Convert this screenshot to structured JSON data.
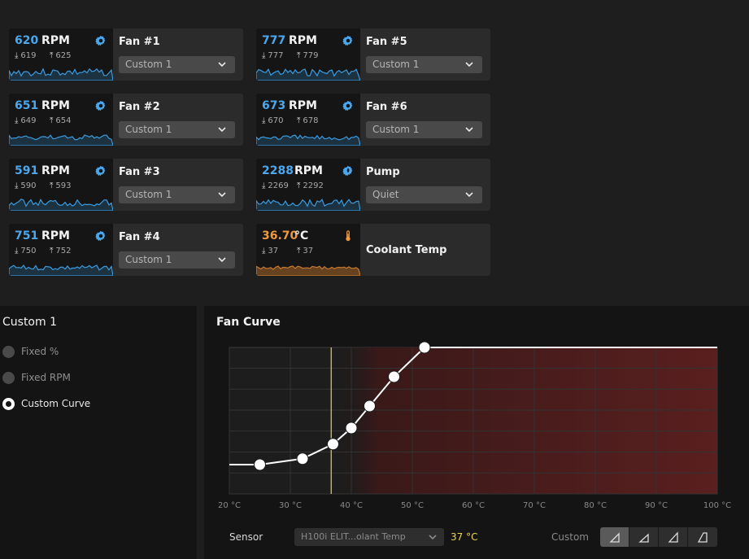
{
  "fans": [
    {
      "id": "fan1",
      "value": "620",
      "unit": "RPM",
      "min": "619",
      "max": "625",
      "name": "Fan #1",
      "preset": "Custom 1",
      "icon": "gear-icon",
      "color": "#4aa8f0"
    },
    {
      "id": "fan2",
      "value": "651",
      "unit": "RPM",
      "min": "649",
      "max": "654",
      "name": "Fan #2",
      "preset": "Custom 1",
      "icon": "gear-icon",
      "color": "#4aa8f0"
    },
    {
      "id": "fan3",
      "value": "591",
      "unit": "RPM",
      "min": "590",
      "max": "593",
      "name": "Fan #3",
      "preset": "Custom 1",
      "icon": "gear-icon",
      "color": "#4aa8f0"
    },
    {
      "id": "fan4",
      "value": "751",
      "unit": "RPM",
      "min": "750",
      "max": "752",
      "name": "Fan #4",
      "preset": "Custom 1",
      "icon": "gear-icon",
      "color": "#4aa8f0"
    },
    {
      "id": "fan5",
      "value": "777",
      "unit": "RPM",
      "min": "777",
      "max": "779",
      "name": "Fan #5",
      "preset": "Custom 1",
      "icon": "gear-icon",
      "color": "#4aa8f0"
    },
    {
      "id": "fan6",
      "value": "673",
      "unit": "RPM",
      "min": "670",
      "max": "678",
      "name": "Fan #6",
      "preset": "Custom 1",
      "icon": "gear-icon",
      "color": "#4aa8f0"
    },
    {
      "id": "pump",
      "value": "2288",
      "unit": "RPM",
      "min": "2269",
      "max": "2292",
      "name": "Pump",
      "preset": "Quiet",
      "icon": "pump-icon",
      "color": "#4aa8f0"
    },
    {
      "id": "coolant",
      "value": "36.70",
      "unit": "°C",
      "min": "37",
      "max": "37",
      "name": "Coolant Temp",
      "preset": "",
      "icon": "thermometer-icon",
      "color": "#ef9a3f"
    }
  ],
  "profile": {
    "title": "Custom 1",
    "modes": [
      {
        "label": "Fixed %",
        "selected": false
      },
      {
        "label": "Fixed RPM",
        "selected": false
      },
      {
        "label": "Custom Curve",
        "selected": true
      }
    ]
  },
  "curve": {
    "title": "Fan Curve",
    "sensor_label": "Sensor",
    "sensor_value": "H100i ELIT...olant Temp",
    "sensor_temp": "37 °C",
    "custom_label": "Custom",
    "presets": [
      "quiet-preset-icon",
      "balanced-preset-icon",
      "performance-preset-icon",
      "extreme-preset-icon"
    ],
    "active_preset": 0
  },
  "chart_data": {
    "type": "line",
    "x_ticks": [
      "20 °C",
      "30 °C",
      "40 °C",
      "50 °C",
      "60 °C",
      "70 °C",
      "80 °C",
      "90 °C",
      "100 °C"
    ],
    "xlim": [
      20,
      100
    ],
    "ylim": [
      0,
      100
    ],
    "current_temp": 36.7,
    "points": [
      {
        "x": 25,
        "y": 20
      },
      {
        "x": 32,
        "y": 24
      },
      {
        "x": 37,
        "y": 34
      },
      {
        "x": 40,
        "y": 45
      },
      {
        "x": 43,
        "y": 60
      },
      {
        "x": 47,
        "y": 80
      },
      {
        "x": 52,
        "y": 100
      }
    ],
    "grid": true
  }
}
